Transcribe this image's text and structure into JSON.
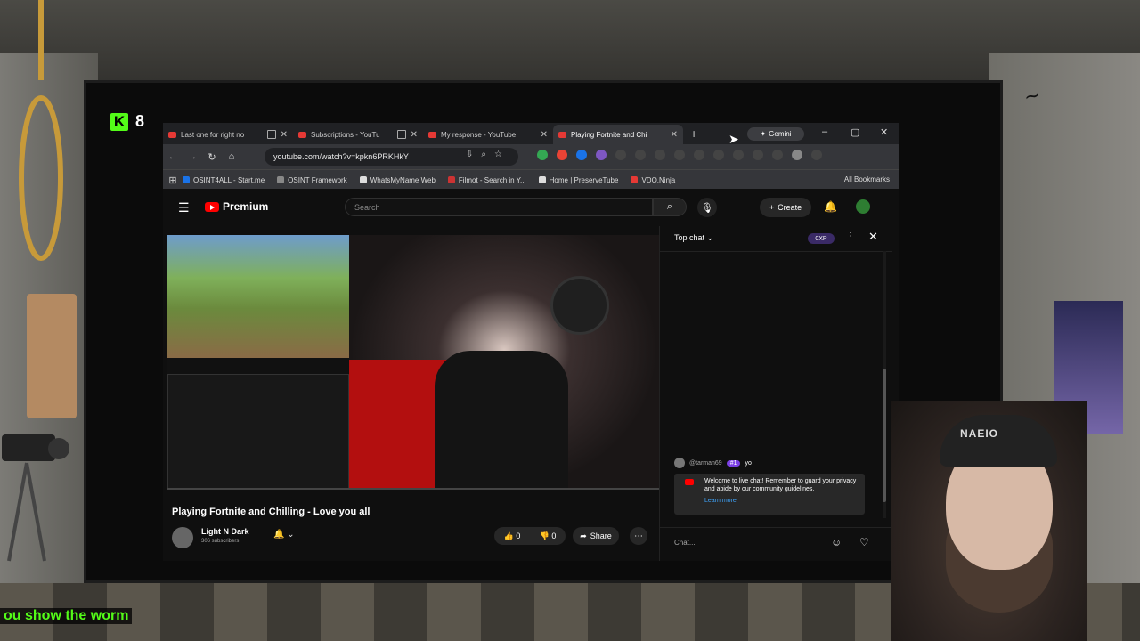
{
  "overlay": {
    "k_count": "8",
    "caption": "ou show the worm",
    "webcam_cap_text": "NAEIO"
  },
  "browser": {
    "tabs": [
      {
        "label": "Last one for right no"
      },
      {
        "label": "Subscriptions - YouTu"
      },
      {
        "label": "My response - YouTube"
      },
      {
        "label": "Playing Fortnite and Chi"
      }
    ],
    "new_tab": "+",
    "gemini_label": "Gemini",
    "window_controls": {
      "minimize": "–",
      "maximize": "▢",
      "close": "✕"
    },
    "url": "youtube.com/watch?v=kpkn6PRKHkY",
    "bookmarks": [
      {
        "label": "OSINT4ALL - Start.me"
      },
      {
        "label": "OSINT Framework"
      },
      {
        "label": "WhatsMyName Web"
      },
      {
        "label": "Filmot - Search in Y..."
      },
      {
        "label": "Home | PreserveTube"
      },
      {
        "label": "VDO.Ninja"
      }
    ],
    "all_bookmarks": "All Bookmarks"
  },
  "youtube": {
    "brand": "Premium",
    "search_placeholder": "Search",
    "create_label": "Create",
    "video_title": "Playing Fortnite and Chilling - Love you all",
    "channel_name": "Light N Dark",
    "channel_subs": "306 subscribers",
    "likes": "0",
    "dislikes": "0",
    "share_label": "Share"
  },
  "chat": {
    "mode_label": "Top chat",
    "xp_badge": "0XP",
    "message": {
      "user": "@tarman69",
      "badge": "#1",
      "text": "yo"
    },
    "welcome_text": "Welcome to live chat! Remember to guard your privacy and abide by our community guidelines.",
    "learn_more": "Learn more",
    "input_placeholder": "Chat..."
  },
  "colors": {
    "kick_green": "#53fc18",
    "youtube_red": "#ff0000",
    "link_blue": "#3ea6ff"
  }
}
